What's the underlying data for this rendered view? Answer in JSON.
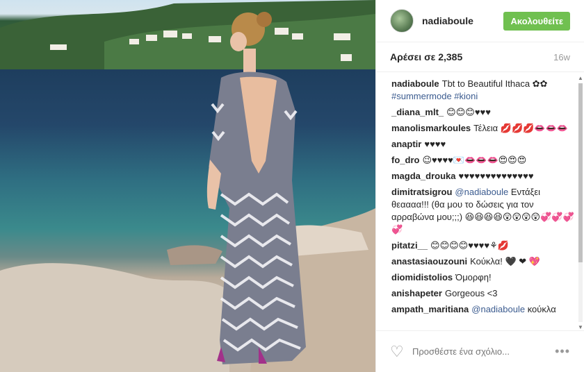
{
  "header": {
    "username": "nadiaboule",
    "follow_label": "Ακολουθείτε"
  },
  "stats": {
    "likes": "Αρέσει σε 2,385",
    "age": "16w"
  },
  "comments": [
    {
      "user": "nadiaboule",
      "text": "Tbt to Beautiful Ithaca ✿✿",
      "tags": "#summermode #kioni"
    },
    {
      "user": "_diana_mlt_",
      "text": "😊😊😊♥♥♥"
    },
    {
      "user": "manolismarkoules",
      "text": "Τέλεια 💋💋💋👄👄👄"
    },
    {
      "user": "anaptir",
      "text": "♥♥♥♥"
    },
    {
      "user": "fo_dro",
      "text": "😉♥♥♥♥💌👄👄👄😍😍😍"
    },
    {
      "user": "magda_drouka",
      "text": "♥♥♥♥♥♥♥♥♥♥♥♥♥♥"
    },
    {
      "user": "dimitratsigrou",
      "mention": "@nadiaboule",
      "text": "Εντάξει θεαααα!!! (θα μου το δώσεις για τον αρραβώνα μου;;;) 😆😆😆😆😲😲😲😲💞💞💞💞"
    },
    {
      "user": "pitatzi__",
      "text": "😊😊😊😊♥♥♥♥⚘💋"
    },
    {
      "user": "anastasiaouzouni",
      "text": "Κούκλα! 🖤 ❤ 💖"
    },
    {
      "user": "diomidistolios",
      "text": "Όμορφη!"
    },
    {
      "user": "anishapeter",
      "text": "Gorgeous <3"
    },
    {
      "user": "ampath_maritiana",
      "mention": "@nadiaboule",
      "text": "κούκλα"
    }
  ],
  "footer": {
    "comment_placeholder": "Προσθέστε ένα σχόλιο...",
    "more_label": "•••"
  },
  "icons": {
    "heart": "heart-outline-icon",
    "more": "ellipsis-icon"
  },
  "colors": {
    "follow_button": "#70c050",
    "hashtag": "#3b5b8f"
  }
}
